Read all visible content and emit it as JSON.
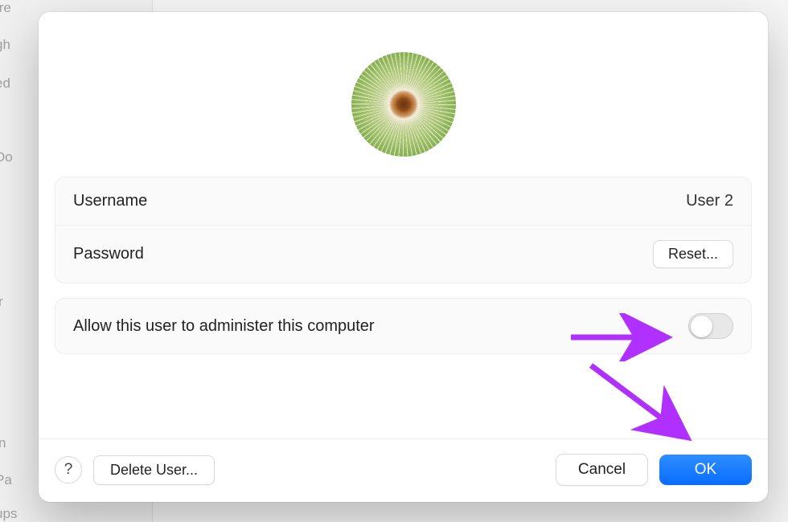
{
  "background": {
    "sidebar_fragments": [
      "tre",
      "gh",
      "ed",
      "Do",
      "r",
      "n",
      "Pa",
      "ups"
    ]
  },
  "dialog": {
    "fields": {
      "username": {
        "label": "Username",
        "value": "User 2"
      },
      "password": {
        "label": "Password",
        "reset_label": "Reset..."
      },
      "admin": {
        "label": "Allow this user to administer this computer",
        "enabled": false
      }
    },
    "footer": {
      "help_label": "?",
      "delete_user_label": "Delete User...",
      "cancel_label": "Cancel",
      "ok_label": "OK"
    }
  },
  "annotations": {
    "arrow_color": "#b030ff"
  }
}
